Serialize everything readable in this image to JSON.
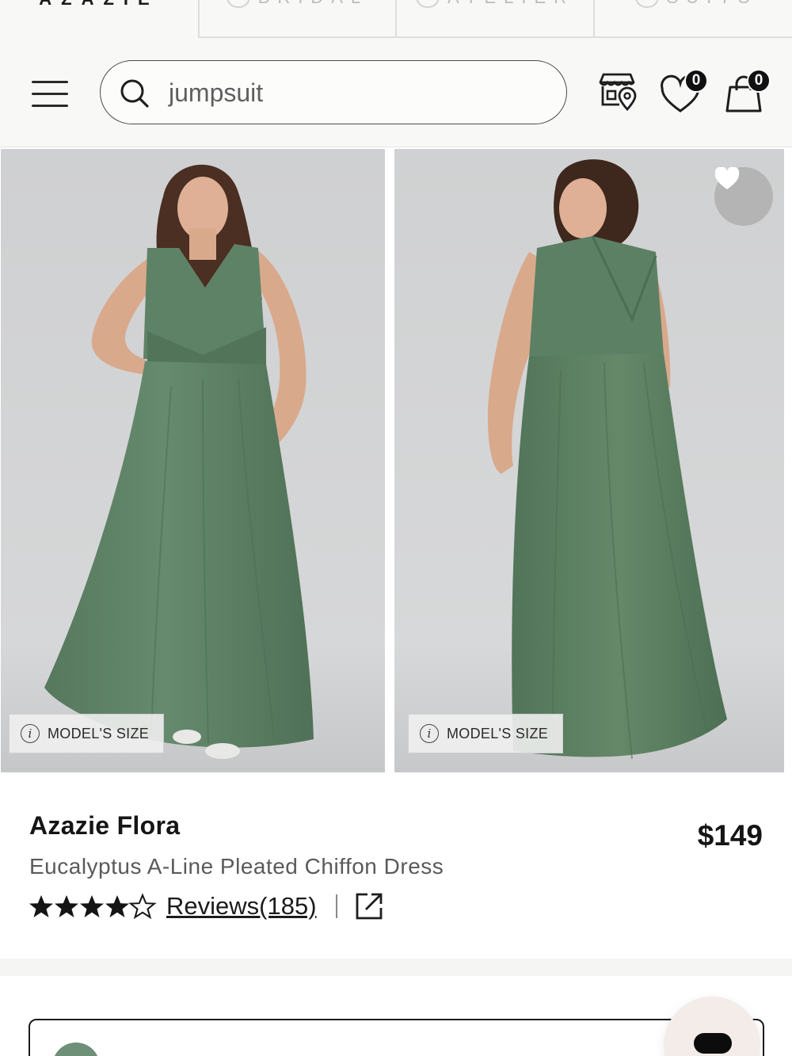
{
  "brand_tabs": [
    {
      "label": "AZAZIE",
      "active": true
    },
    {
      "label": "BRIDAL",
      "active": false
    },
    {
      "label": "ATELIER",
      "active": false
    },
    {
      "label": "SUITS",
      "active": false
    }
  ],
  "header": {
    "search_value": "jumpsuit",
    "wishlist_count": "0",
    "cart_count": "0",
    "icons": [
      "menu-icon",
      "search-icon",
      "store-locator-icon",
      "heart-icon",
      "shopping-bag-icon"
    ]
  },
  "gallery": {
    "model_size_label": "MODEL'S SIZE",
    "dress_color": "#5f8467",
    "background_color": "#d3d4d5"
  },
  "product": {
    "name": "Azazie Flora",
    "price": "$149",
    "description": "Eucalyptus A-Line Pleated Chiffon Dress",
    "rating": 4.5,
    "reviews_label": "Reviews(185)"
  },
  "colors": {
    "text": "#151515",
    "muted": "#5a5a5a",
    "swatch_green": "#6e8f78"
  }
}
